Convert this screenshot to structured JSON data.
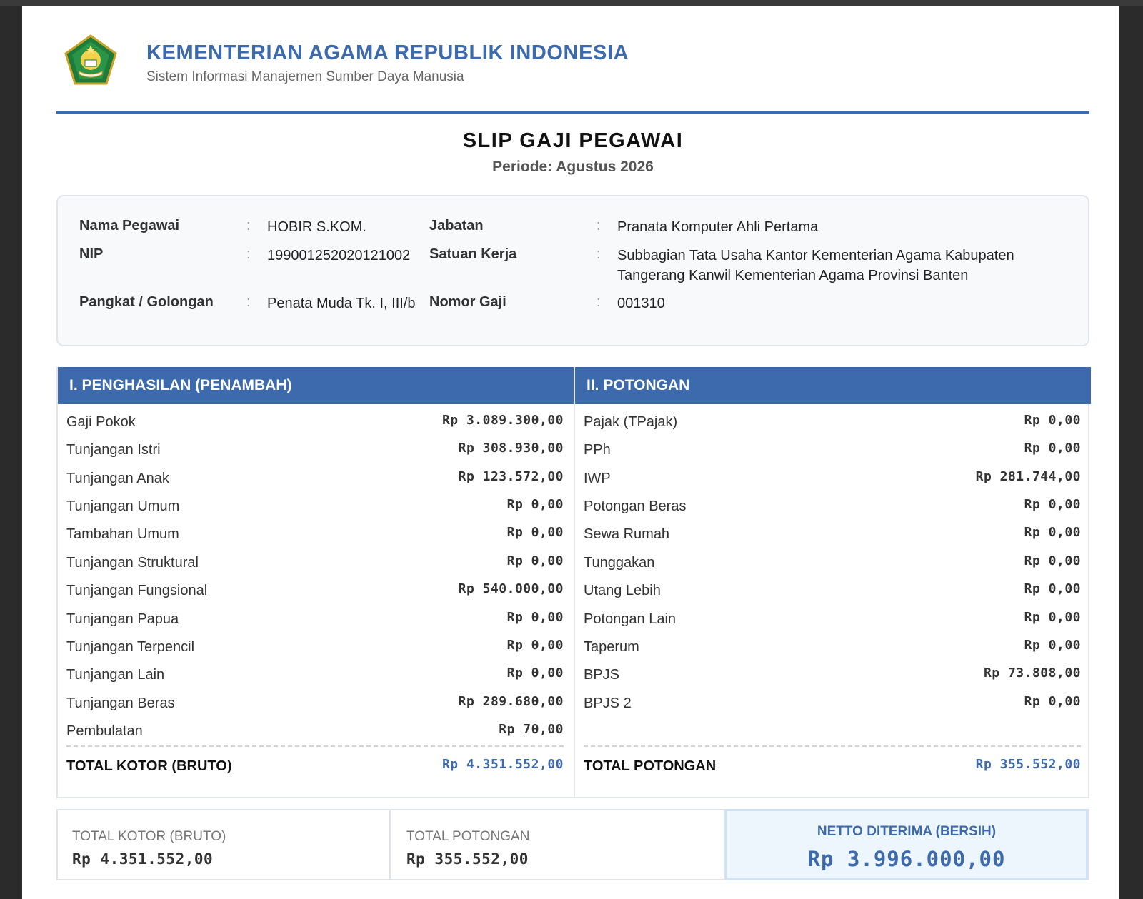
{
  "header": {
    "org_title": "KEMENTERIAN AGAMA REPUBLIK INDONESIA",
    "org_subtitle": "Sistem Informasi Manajemen Sumber Daya Manusia",
    "logo_icon": "kementerian-agama-emblem",
    "accent_color": "#3c6aad"
  },
  "document": {
    "title": "SLIP GAJI PEGAWAI",
    "period": "Periode: Agustus 2026"
  },
  "employee": {
    "name_label": "Nama Pegawai",
    "name": "HOBIR S.KOM.",
    "nip_label": "NIP",
    "nip": "199001252020121002",
    "rank_label": "Pangkat / Golongan",
    "rank": "Penata Muda Tk. I, III/b",
    "position_label": "Jabatan",
    "position": "Pranata Komputer Ahli Pertama",
    "unit_label": "Satuan Kerja",
    "unit": "Subbagian Tata Usaha Kantor Kementerian Agama Kabupaten Tangerang Kanwil Kementerian Agama Provinsi Banten",
    "salary_no_label": "Nomor Gaji",
    "salary_no": "001310",
    "colon": ":"
  },
  "income": {
    "heading": "I. PENGHASILAN (PENAMBAH)",
    "items": [
      {
        "label": "Gaji Pokok",
        "value": "Rp 3.089.300,00"
      },
      {
        "label": "Tunjangan Istri",
        "value": "Rp 308.930,00"
      },
      {
        "label": "Tunjangan Anak",
        "value": "Rp 123.572,00"
      },
      {
        "label": "Tunjangan Umum",
        "value": "Rp 0,00"
      },
      {
        "label": "Tambahan Umum",
        "value": "Rp 0,00"
      },
      {
        "label": "Tunjangan Struktural",
        "value": "Rp 0,00"
      },
      {
        "label": "Tunjangan Fungsional",
        "value": "Rp 540.000,00"
      },
      {
        "label": "Tunjangan Papua",
        "value": "Rp 0,00"
      },
      {
        "label": "Tunjangan Terpencil",
        "value": "Rp 0,00"
      },
      {
        "label": "Tunjangan Lain",
        "value": "Rp 0,00"
      },
      {
        "label": "Tunjangan Beras",
        "value": "Rp 289.680,00"
      },
      {
        "label": "Pembulatan",
        "value": "Rp 70,00"
      }
    ],
    "total_label": "TOTAL KOTOR (BRUTO)",
    "total_value": "Rp 4.351.552,00"
  },
  "deductions": {
    "heading": "II. POTONGAN",
    "items": [
      {
        "label": "Pajak (TPajak)",
        "value": "Rp 0,00"
      },
      {
        "label": "PPh",
        "value": "Rp 0,00"
      },
      {
        "label": "IWP",
        "value": "Rp 281.744,00"
      },
      {
        "label": "Potongan Beras",
        "value": "Rp 0,00"
      },
      {
        "label": "Sewa Rumah",
        "value": "Rp 0,00"
      },
      {
        "label": "Tunggakan",
        "value": "Rp 0,00"
      },
      {
        "label": "Utang Lebih",
        "value": "Rp 0,00"
      },
      {
        "label": "Potongan Lain",
        "value": "Rp 0,00"
      },
      {
        "label": "Taperum",
        "value": "Rp 0,00"
      },
      {
        "label": "BPJS",
        "value": "Rp 73.808,00"
      },
      {
        "label": "BPJS 2",
        "value": "Rp 0,00"
      }
    ],
    "total_label": "TOTAL POTONGAN",
    "total_value": "Rp 355.552,00"
  },
  "summary": {
    "gross_label": "TOTAL KOTOR (BRUTO)",
    "gross_value": "Rp 4.351.552,00",
    "deduction_label": "TOTAL POTONGAN",
    "deduction_value": "Rp 355.552,00",
    "net_label": "NETTO DITERIMA (BERSIH)",
    "net_value": "Rp 3.996.000,00"
  }
}
